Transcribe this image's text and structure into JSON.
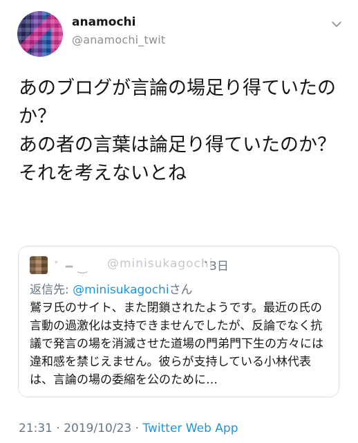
{
  "author": {
    "display_name": "anamochi",
    "handle": "@anamochi_twit"
  },
  "tweet": {
    "text": "あのブログが言論の場足り得ていたのか？\nあの者の言葉は論足り得ていたのか？\nそれを考えないとね"
  },
  "quoted_tweet": {
    "name": "ﾞ ━  ‿",
    "handle": "@minisukagochi",
    "separator": "·",
    "time": "3日",
    "reply_prefix": "返信先: ",
    "reply_mention": "@minisukagochi",
    "reply_suffix": "さん",
    "text": "鷲ヲ氏のサイト、また閉鎖されたようです。最近の氏の言動の過激化は支持できませんでしたが、反論でなく抗議で発言の場を消滅させた道場の門弟門下生の方々には違和感を禁じえません。彼らが支持している小林代表は、言論の場の委縮を公のために…"
  },
  "meta": {
    "time": "21:31",
    "separator": " · ",
    "date": "2019/10/23",
    "separator2": " · ",
    "app": "Twitter Web App"
  },
  "colors": {
    "link": "#1b95e0",
    "secondary_text": "#657786",
    "border": "#dadfe3"
  },
  "icons": {
    "menu": "chevron-down-icon"
  }
}
